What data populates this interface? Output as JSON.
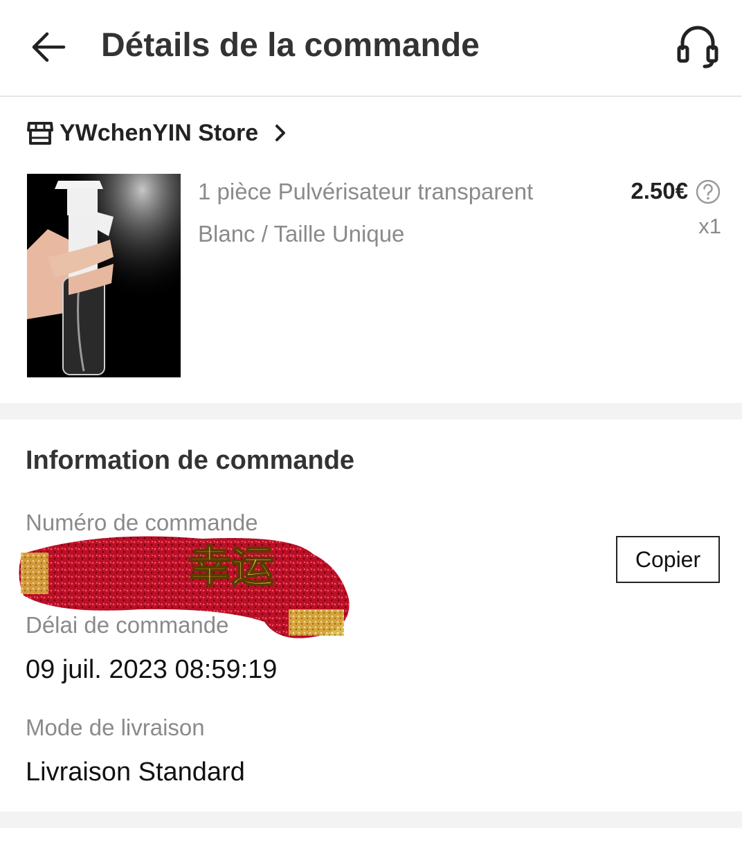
{
  "header": {
    "title": "Détails de la commande",
    "back_icon": "arrow-left-icon",
    "support_icon": "headset-icon"
  },
  "store": {
    "icon": "store-icon",
    "name": "YWchenYIN Store",
    "chevron_icon": "chevron-right-icon"
  },
  "product": {
    "name": "1 pièce Pulvérisateur transparent",
    "variant": "Blanc / Taille Unique",
    "price": "2.50€",
    "help_icon": "question-circle-icon",
    "quantity": "x1"
  },
  "order_info": {
    "title": "Information de commande",
    "order_number_label": "Numéro de commande",
    "copy_label": "Copier",
    "redaction_text": "幸运",
    "order_time_label": "Délai de commande",
    "order_time_value": "09 juil. 2023 08:59:19",
    "shipping_label": "Mode de livraison",
    "shipping_value": "Livraison Standard"
  },
  "colors": {
    "background": "#ffffff",
    "band": "#f3f3f3",
    "muted_text": "#8a8a8a",
    "redaction_red": "#c8102e",
    "redaction_gold": "#e3c04a"
  }
}
